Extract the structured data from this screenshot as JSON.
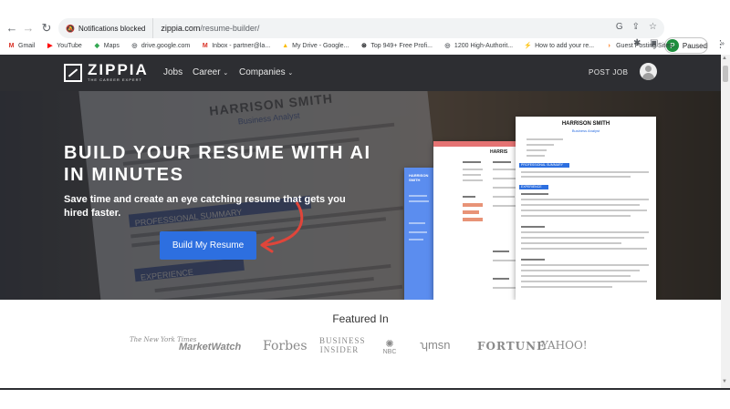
{
  "browser": {
    "notification_chip": "Notifications blocked",
    "url_host": "zippia.com",
    "url_path": "/resume-builder/",
    "profile_initial": "P",
    "profile_status": "Paused"
  },
  "bookmarks": [
    {
      "label": "Gmail",
      "icon": "gmail-icon",
      "color": "#d93025",
      "glyph": "M"
    },
    {
      "label": "YouTube",
      "icon": "youtube-icon",
      "color": "#ff0000",
      "glyph": "▶"
    },
    {
      "label": "Maps",
      "icon": "maps-icon",
      "color": "#34a853",
      "glyph": "◆"
    },
    {
      "label": "drive.google.com",
      "icon": "globe-icon",
      "color": "#5f6368",
      "glyph": "◎"
    },
    {
      "label": "Inbox - partner@la...",
      "icon": "gmail-icon",
      "color": "#d93025",
      "glyph": "M"
    },
    {
      "label": "My Drive - Google...",
      "icon": "drive-icon",
      "color": "#fbbc04",
      "glyph": "▲"
    },
    {
      "label": "Top 949+ Free Profi...",
      "icon": "bookmark-site-icon",
      "color": "#202124",
      "glyph": "⊛"
    },
    {
      "label": "1200 High-Authorit...",
      "icon": "globe-icon",
      "color": "#5f6368",
      "glyph": "◎"
    },
    {
      "label": "How to add your re...",
      "icon": "bolt-icon",
      "color": "#34a853",
      "glyph": "⚡"
    },
    {
      "label": "Guest Posting Sites...",
      "icon": "arrow-site-icon",
      "color": "#ff6d00",
      "glyph": "›"
    }
  ],
  "site": {
    "logo_word": "ZIPPIA",
    "logo_tagline": "THE CAREER EXPERT",
    "nav": {
      "jobs": "Jobs",
      "career": "Career",
      "companies": "Companies",
      "post_job": "POST JOB"
    },
    "hero": {
      "headline": "BUILD YOUR RESUME WITH AI IN MINUTES",
      "subhead": "Save time and create an eye catching resume that gets you hired faster.",
      "cta": "Build My Resume"
    },
    "background_resume": {
      "name": "HARRISON SMITH",
      "role": "Business Analyst",
      "section_a": "PROFESSIONAL SUMMARY",
      "section_b": "EXPERIENCE"
    },
    "resume_cards": {
      "card1_name": "HARRISON SMITH",
      "card2_name": "HARRIS",
      "card3_name": "HARRISON SMITH",
      "card3_role": "Business Analyst",
      "card3_summary": "PROFESSIONAL SUMMARY",
      "card3_experience": "EXPERIENCE"
    },
    "featured": {
      "title": "Featured In",
      "logos": [
        "The New York Times",
        "MarketWatch",
        "Forbes",
        "BUSINESS INSIDER",
        "NBC",
        "msn",
        "FORTUNE",
        "YAHOO!"
      ]
    }
  },
  "colors": {
    "cta": "#2d6fe0",
    "navbar": "#2d2e32",
    "arrow": "#e0453a"
  }
}
